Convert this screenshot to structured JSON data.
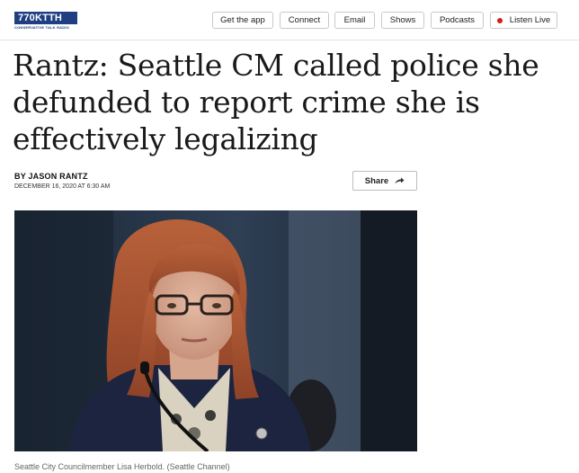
{
  "header": {
    "logo": {
      "prefix": "770",
      "brand": "KTTH",
      "tagline": "CONSERVATIVE TALK RADIO"
    },
    "nav": [
      {
        "label": "Get the app"
      },
      {
        "label": "Connect"
      },
      {
        "label": "Email"
      },
      {
        "label": "Shows"
      },
      {
        "label": "Podcasts"
      },
      {
        "label": "Listen Live"
      }
    ]
  },
  "article": {
    "headline": "Rantz: Seattle CM called police she defunded to report crime she is effectively legalizing",
    "byline": "BY JASON RANTZ",
    "date": "DECEMBER 16, 2020 AT 6:30 AM",
    "share_label": "Share",
    "caption": "Seattle City Councilmember Lisa Herbold. (Seattle Channel)"
  },
  "colors": {
    "brand_blue": "#1f3f82",
    "live_red": "#d11e1e"
  },
  "icons": {
    "share": "share-arrow-icon",
    "live": "live-dot-icon"
  }
}
